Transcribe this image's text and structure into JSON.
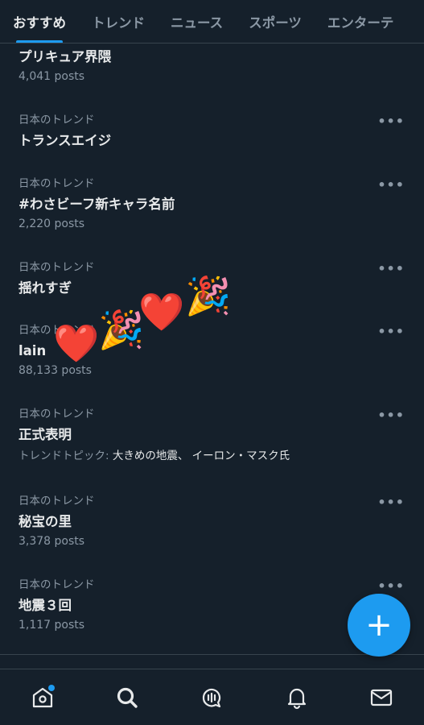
{
  "tabs": [
    {
      "label": "おすすめ",
      "active": true
    },
    {
      "label": "トレンド",
      "active": false
    },
    {
      "label": "ニュース",
      "active": false
    },
    {
      "label": "スポーツ",
      "active": false
    },
    {
      "label": "エンターテ",
      "active": false
    }
  ],
  "trends": [
    {
      "meta": "",
      "title": "プリキュア界隈",
      "count": "4,041 posts"
    },
    {
      "meta": "日本のトレンド",
      "title": "トランスエイジ",
      "count": ""
    },
    {
      "meta": "日本のトレンド",
      "title": "#わさビーフ新キャラ名前",
      "count": "2,220 posts"
    },
    {
      "meta": "日本のトレンド",
      "title": "揺れすぎ",
      "count": ""
    },
    {
      "meta": "日本のトレンド",
      "title": "lain",
      "count": "88,133 posts"
    },
    {
      "meta": "日本のトレンド",
      "title": "正式表明",
      "topic_label": "トレンドトピック:",
      "topic_value": "大きめの地震、 イーロン・マスク氏"
    },
    {
      "meta": "日本のトレンド",
      "title": "秘宝の里",
      "count": "3,378 posts"
    },
    {
      "meta": "日本のトレンド",
      "title": "地震３回",
      "count": "1,117 posts"
    }
  ],
  "more_label": "•••",
  "decorations": [
    "❤️",
    "🎉",
    "❤️",
    "🎉"
  ],
  "fab_icon": "+",
  "colors": {
    "background": "#15202b",
    "accent": "#1d9bf0",
    "divider": "#38444d",
    "muted": "#8b98a5",
    "text": "#e7e9ea"
  },
  "nav_icons": [
    "home-icon",
    "search-icon",
    "spaces-icon",
    "notifications-icon",
    "messages-icon"
  ]
}
